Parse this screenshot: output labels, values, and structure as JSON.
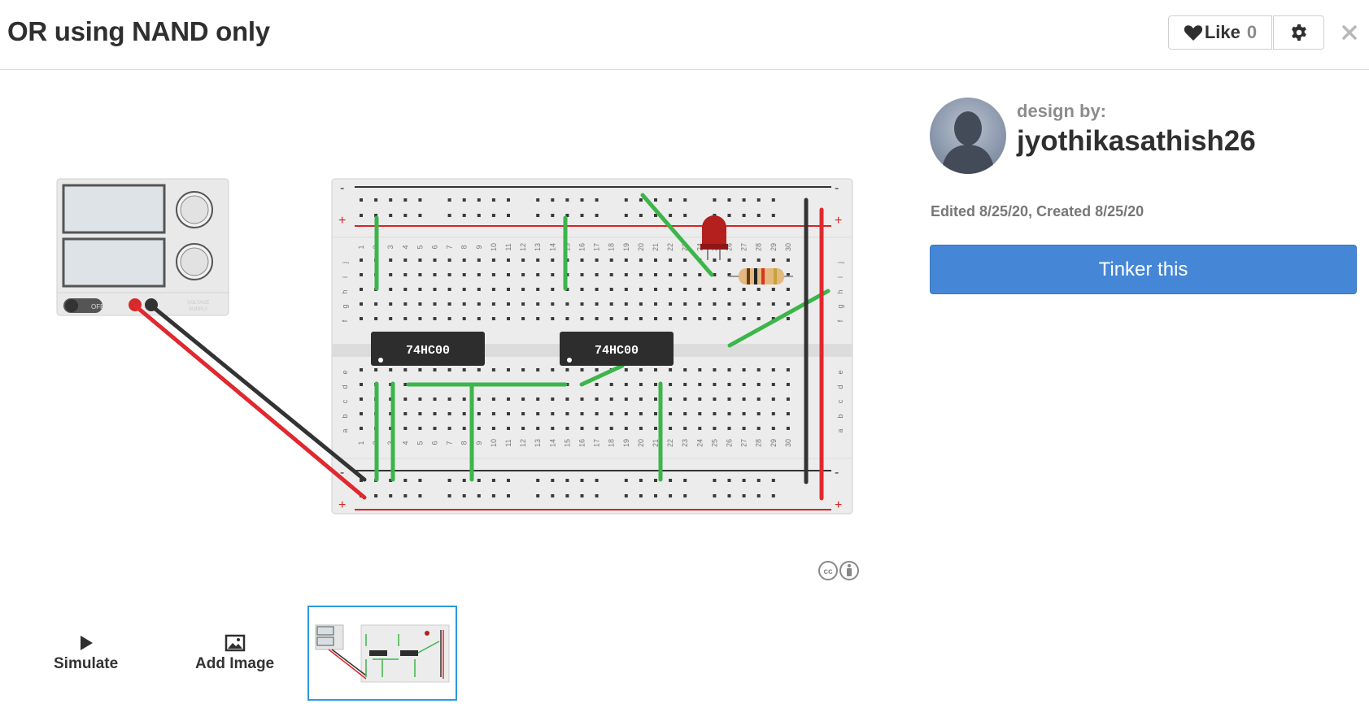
{
  "header": {
    "title": "OR using NAND only",
    "like_label": "Like",
    "like_count": "0",
    "icons": {
      "like": "heart-icon",
      "settings": "gear-icon",
      "close": "close-icon"
    }
  },
  "circuit": {
    "chip_label_1": "74HC00",
    "chip_label_2": "74HC00",
    "power_switch_label": "OFF",
    "supply_label_1": "VOLTAGE",
    "supply_label_2": "SUPPLY",
    "row_letters_top": [
      "j",
      "i",
      "h",
      "g",
      "f"
    ],
    "row_letters_bottom": [
      "e",
      "d",
      "c",
      "b",
      "a"
    ],
    "column_count": 30,
    "rail_minus": "-",
    "rail_plus": "+",
    "colors": {
      "wire_green": "#3cb54a",
      "wire_red": "#e0282e",
      "wire_black": "#333333",
      "chip": "#2d2d2d"
    }
  },
  "author": {
    "design_by_label": "design by:",
    "username": "jyothikasathish26",
    "dates": "Edited 8/25/20, Created 8/25/20"
  },
  "actions": {
    "tinker_label": "Tinker this",
    "simulate_label": "Simulate",
    "add_image_label": "Add Image"
  },
  "colors": {
    "accent": "#4587d6",
    "thumb_border": "#2b9ae0"
  }
}
